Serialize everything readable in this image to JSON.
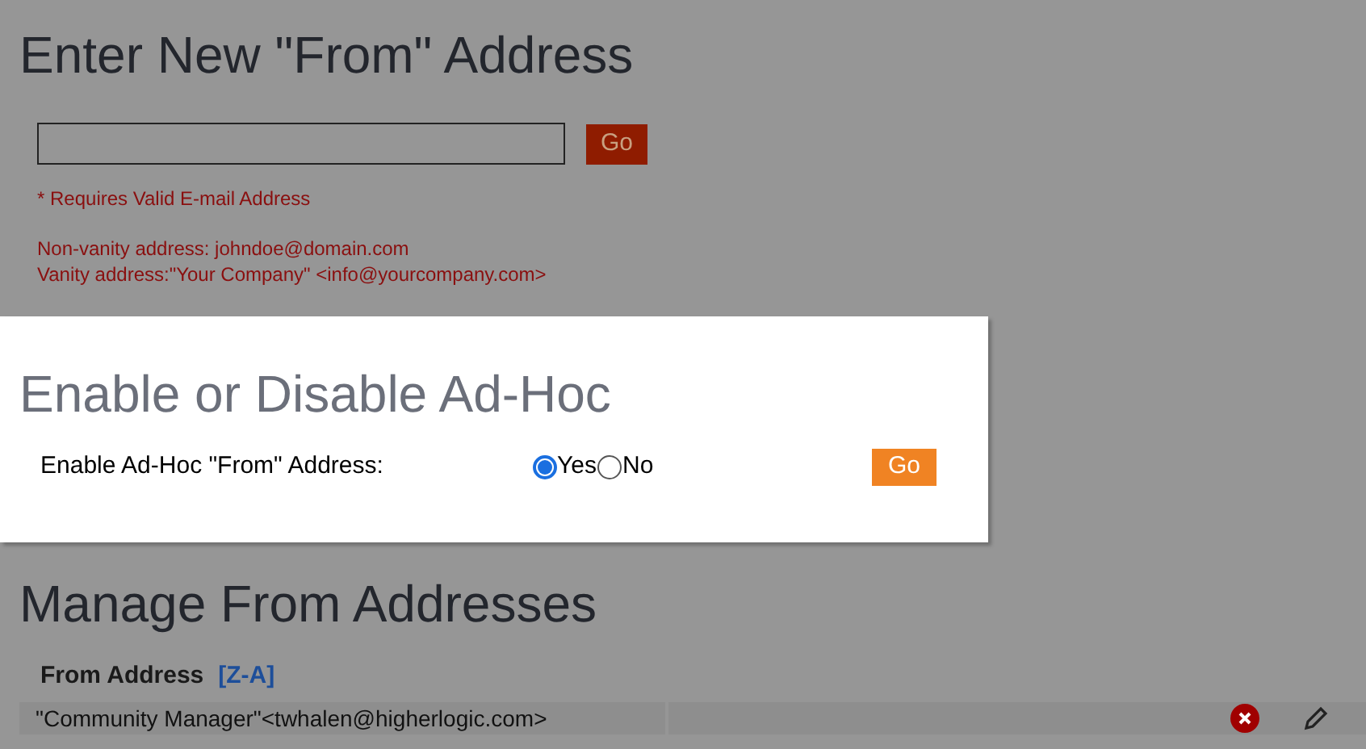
{
  "from_section": {
    "title": "Enter New \"From\" Address",
    "go_button": "Go",
    "requirement_note": "* Requires Valid E-mail Address",
    "examples": [
      "Non-vanity address: johndoe@domain.com",
      "Vanity address:\"Your Company\" <info@yourcompany.com>"
    ]
  },
  "adhoc_section": {
    "title": "Enable or Disable Ad-Hoc",
    "label": "Enable Ad-Hoc \"From\" Address:",
    "options": [
      {
        "label": "Yes",
        "selected": true
      },
      {
        "label": "No",
        "selected": false
      }
    ],
    "go_button": "Go"
  },
  "manage_section": {
    "title": "Manage From Addresses",
    "column": {
      "label": "From Address",
      "sort_link": "[Z-A]"
    },
    "rows": [
      {
        "address": "\"Community Manager\"<twhalen@higherlogic.com>"
      }
    ]
  }
}
